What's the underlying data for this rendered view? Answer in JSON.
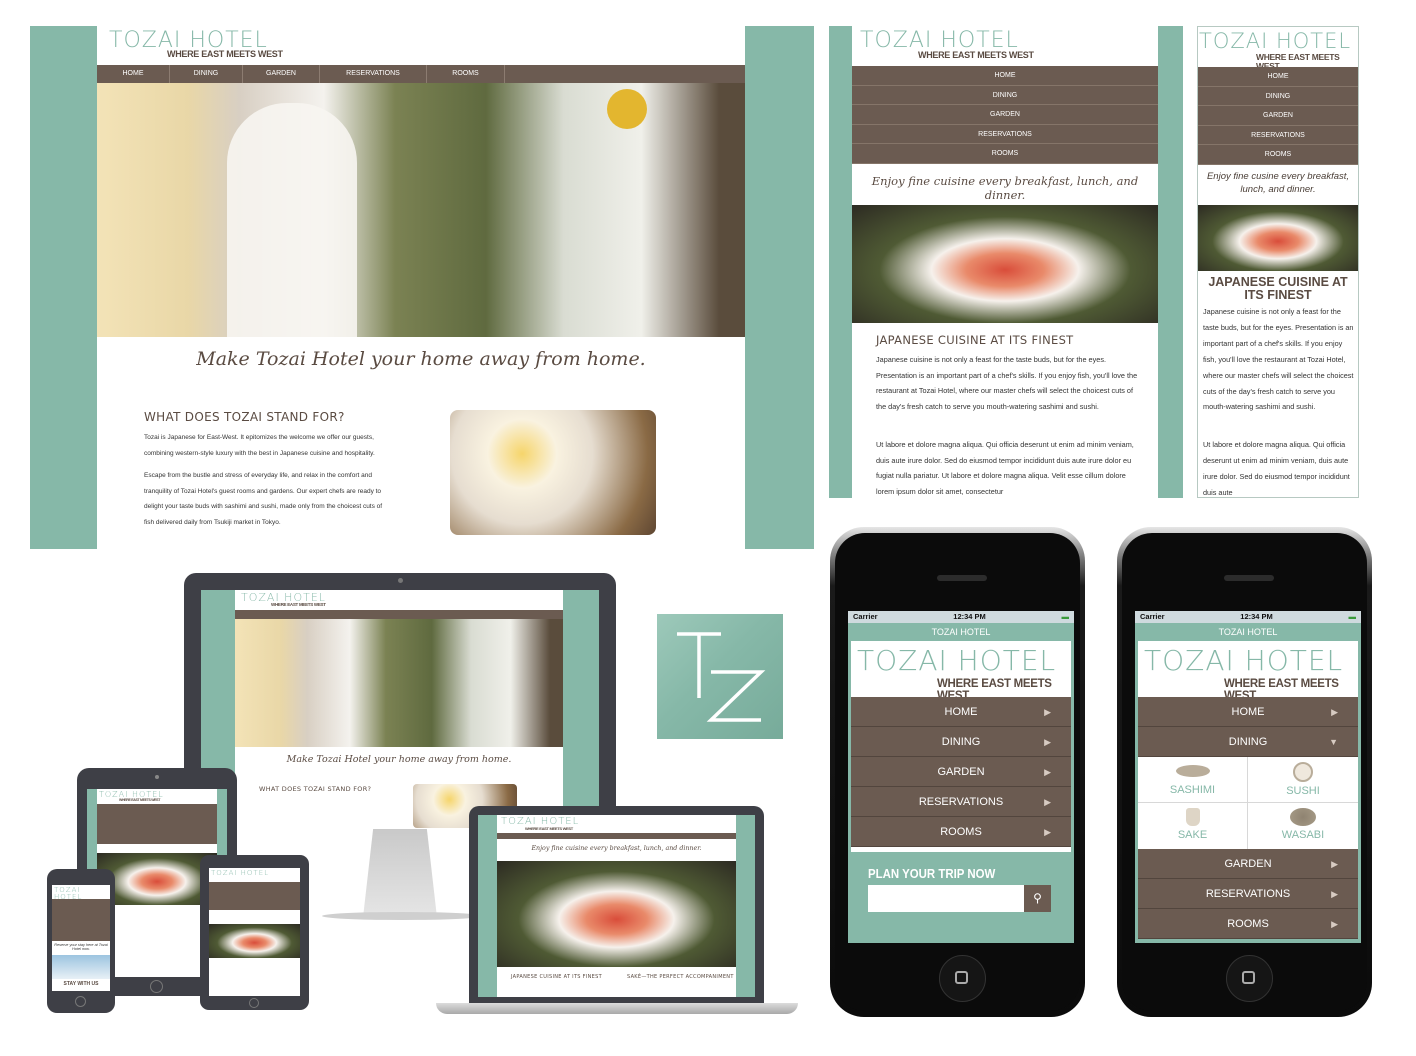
{
  "brand": {
    "name": "TOZAI HOTEL",
    "tagline": "WHERE EAST MEETS WEST",
    "monogram": "TZ",
    "colors": {
      "teal": "#86b8a8",
      "brown": "#6b5b51",
      "text": "#5a4b42"
    }
  },
  "desktop": {
    "nav": [
      "HOME",
      "DINING",
      "GARDEN",
      "RESERVATIONS",
      "ROOMS"
    ],
    "script_tagline": "Make Tozai Hotel your home away from home.",
    "section_title": "WHAT DOES TOZAI STAND FOR?",
    "paragraph1": "Tozai is Japanese for East-West. It epitomizes the welcome we offer our guests, combining western-style luxury with the best in Japanese cuisine and hospitality.",
    "paragraph2": "Escape from the bustle and stress of everyday life, and relax in the comfort and tranquility of Tozai Hotel's guest rooms and gardens. Our expert chefs are ready to delight your taste buds with sashimi and sushi, made only from the choicest cuts of fish delivered daily from Tsukiji market in Tokyo."
  },
  "tablet": {
    "nav": [
      "HOME",
      "DINING",
      "GARDEN",
      "RESERVATIONS",
      "ROOMS"
    ],
    "script_tagline": "Enjoy fine cuisine every breakfast, lunch, and dinner.",
    "section_title": "JAPANESE CUISINE AT ITS FINEST",
    "paragraph1": "Japanese cuisine is not only a feast for the taste buds, but for the eyes. Presentation is an important part of a chef's skills. If you enjoy fish, you'll love the restaurant at Tozai Hotel, where our master chefs will select the choicest cuts of the day's fresh catch to serve you mouth-watering sashimi and sushi.",
    "paragraph2": "Ut labore et dolore magna aliqua. Qui officia deserunt ut enim ad minim veniam, duis aute irure dolor. Sed do eiusmod tempor incididunt duis aute irure dolor eu fugiat nulla pariatur. Ut labore et dolore magna aliqua. Velit esse cillum dolore lorem ipsum dolor sit amet, consectetur"
  },
  "phone": {
    "nav": [
      "HOME",
      "DINING",
      "GARDEN",
      "RESERVATIONS",
      "ROOMS"
    ],
    "script_tagline": "Enjoy fine cusine every breakfast, lunch, and dinner.",
    "section_title": "JAPANESE CUISINE AT ITS FINEST",
    "paragraph1": "Japanese cuisine is not only a feast for the taste buds, but for the eyes. Presentation is an important part of a chef's skills. If you enjoy fish, you'll love the restaurant at Tozai Hotel, where our master chefs will select the choicest cuts of the day's fresh catch to serve you mouth-watering sashimi and sushi.",
    "paragraph2": "Ut labore et dolore magna aliqua. Qui officia deserunt ut enim ad minim veniam, duis aute irure dolor. Sed do eiusmod tempor incididunt duis aute"
  },
  "mockups": {
    "laptop_section1": "JAPANESE CUISINE AT ITS FINEST",
    "laptop_section2": "SAKÉ—THE PERFECT ACCOMPANIMENT",
    "small_phone_note": "Reserve your stay here at Tozai Hotel now.",
    "small_phone_cta": "STAY WITH US"
  },
  "iphone_left": {
    "carrier": "Carrier",
    "time": "12:34 PM",
    "header": "TOZAI HOTEL",
    "menu": [
      "HOME",
      "DINING",
      "GARDEN",
      "RESERVATIONS",
      "ROOMS"
    ],
    "plan_title": "PLAN YOUR TRIP NOW",
    "search_value": ""
  },
  "iphone_right": {
    "carrier": "Carrier",
    "time": "12:34 PM",
    "header": "TOZAI HOTEL",
    "menu_top": [
      "HOME",
      "DINING"
    ],
    "dining_items": [
      "SASHIMI",
      "SUSHI",
      "SAKE",
      "WASABI"
    ],
    "menu_bottom": [
      "GARDEN",
      "RESERVATIONS",
      "ROOMS"
    ]
  }
}
